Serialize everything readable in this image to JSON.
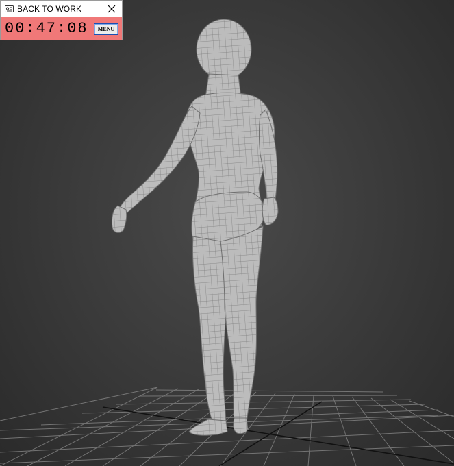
{
  "timer_window": {
    "title": "BACK TO WORK",
    "time": "00:47:08",
    "menu_label": "MENU",
    "app_icon": "cassette-icon",
    "close_icon": "close-icon",
    "background_color": "#f07878"
  },
  "viewport": {
    "background_color": "#3c3c3c",
    "model": "female-base-mesh-wireframe",
    "grid_color": "#808080",
    "mesh_color": "#bdbdbd"
  }
}
